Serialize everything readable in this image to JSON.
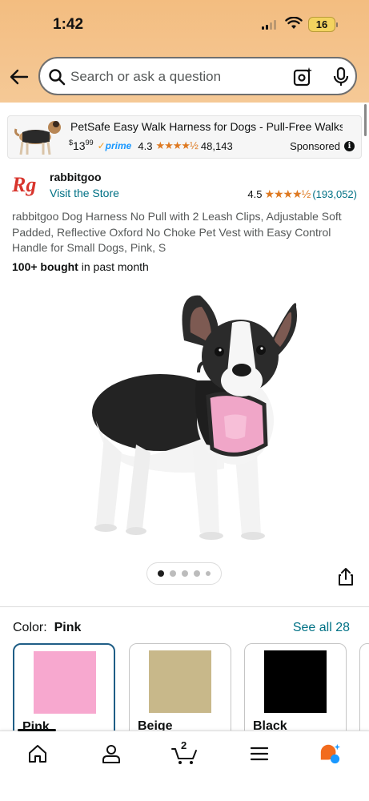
{
  "status_bar": {
    "time": "1:42",
    "battery": "16"
  },
  "search": {
    "placeholder": "Search or ask a question"
  },
  "sponsored": {
    "title": "PetSafe Easy Walk Harness for Dogs - Pull-Free Walks -...",
    "price_symbol": "$",
    "price_whole": "13",
    "price_cents": "99",
    "prime_label": "prime",
    "rating": "4.3",
    "stars": "★★★★½",
    "review_count": "48,143",
    "label": "Sponsored"
  },
  "product": {
    "brand": "rabbitgoo",
    "visit_store": "Visit the Store",
    "rating": "4.5",
    "stars": "★★★★½",
    "rating_count": "(193,052)",
    "title": "rabbitgoo Dog Harness No Pull with 2 Leash Clips, Adjustable Soft Padded, Reflective Oxford No Choke Pet Vest with Easy Control Handle for Small Dogs, Pink, S",
    "bought_bold": "100+ bought",
    "bought_rest": " in past month",
    "image_count": 5,
    "active_image_index": 0
  },
  "color": {
    "label": "Color:",
    "selected": "Pink",
    "see_all": "See all 28",
    "options": [
      {
        "name": "Pink",
        "hex": "#f7a8cf"
      },
      {
        "name": "Beige",
        "hex": "#c8b88a"
      },
      {
        "name": "Black",
        "hex": "#000000"
      }
    ]
  },
  "bottom_nav": {
    "cart_count": "2",
    "items": [
      "home-icon",
      "account-icon",
      "cart-icon",
      "menu-icon",
      "rufus-icon"
    ]
  },
  "colors": {
    "link": "#007185",
    "star": "#de7921",
    "prime": "#1a98ff",
    "header": "#f4c48e"
  }
}
